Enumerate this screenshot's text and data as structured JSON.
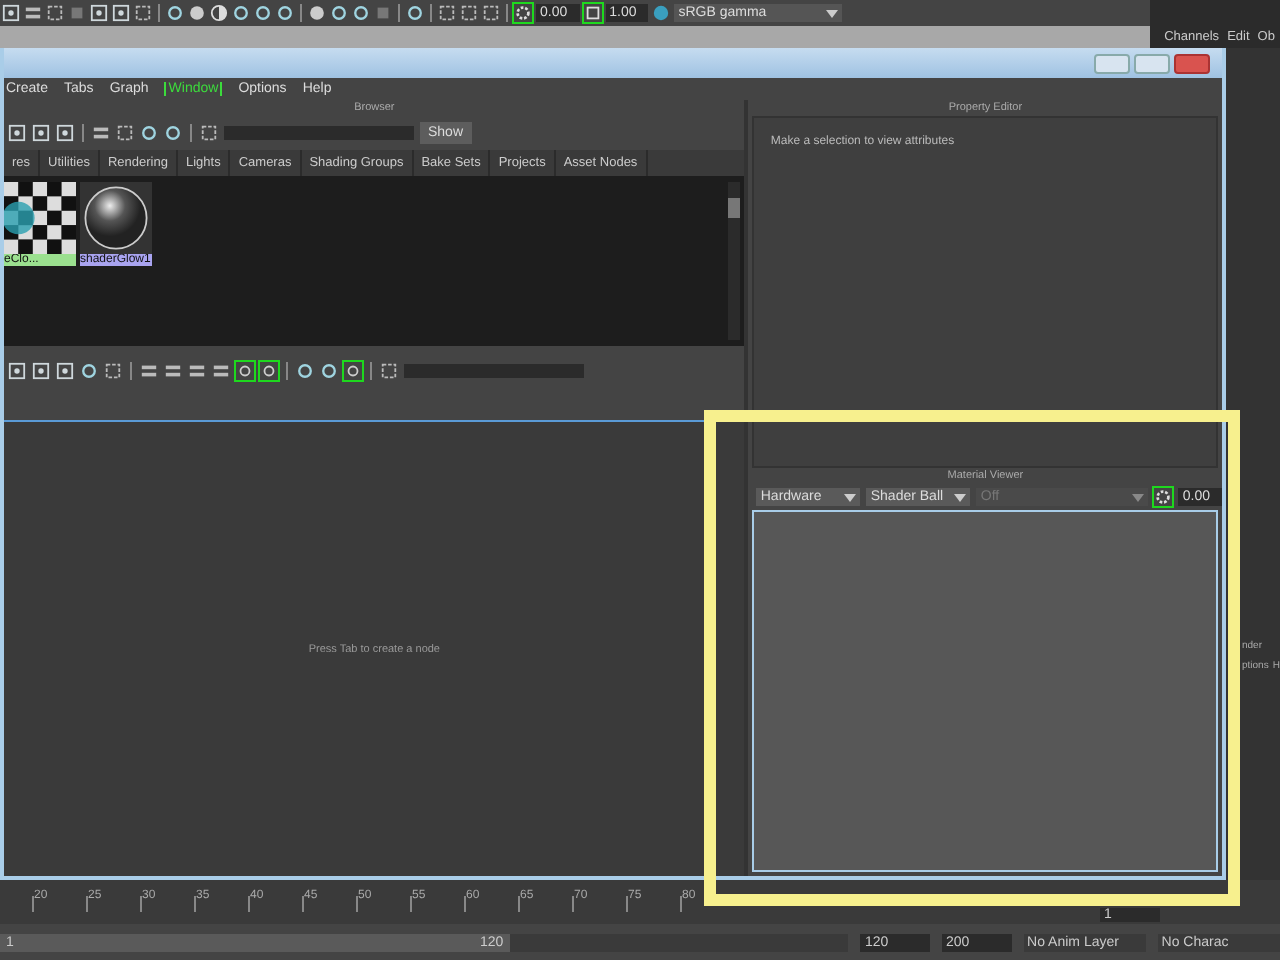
{
  "top_toolbar": {
    "gain": "0.00",
    "gamma": "1.00",
    "color_space": "sRGB gamma"
  },
  "channel_box": {
    "menu": [
      "Channels",
      "Edit",
      "Ob"
    ]
  },
  "window": {
    "menu": [
      {
        "label": "Create",
        "highlighted": false
      },
      {
        "label": "Tabs",
        "highlighted": false
      },
      {
        "label": "Graph",
        "highlighted": false
      },
      {
        "label": "Window",
        "highlighted": true
      },
      {
        "label": "Options",
        "highlighted": false
      },
      {
        "label": "Help",
        "highlighted": false
      }
    ]
  },
  "browser": {
    "title": "Browser",
    "show_button": "Show",
    "tabs": [
      {
        "label": "res",
        "selected": false
      },
      {
        "label": "Utilities",
        "selected": false
      },
      {
        "label": "Rendering",
        "selected": false
      },
      {
        "label": "Lights",
        "selected": false
      },
      {
        "label": "Cameras",
        "selected": false
      },
      {
        "label": "Shading Groups",
        "selected": false
      },
      {
        "label": "Bake Sets",
        "selected": false
      },
      {
        "label": "Projects",
        "selected": false
      },
      {
        "label": "Asset Nodes",
        "selected": false
      }
    ],
    "swatches": [
      {
        "kind": "checker",
        "label": "eClo...",
        "color": "#9be08f"
      },
      {
        "kind": "sphere",
        "label": "shaderGlow1",
        "color": "#a9a4f0"
      }
    ]
  },
  "graph": {
    "hint": "Press Tab to create a node"
  },
  "property_editor": {
    "title": "Property Editor",
    "message": "Make a selection to view attributes"
  },
  "material_viewer": {
    "title": "Material Viewer",
    "renderer": "Hardware",
    "geometry": "Shader Ball",
    "environment": {
      "value": "Off",
      "disabled": true
    },
    "exposure": "0.00"
  },
  "side_panel": {
    "texts": [
      "nder",
      "ptions",
      "H"
    ]
  },
  "timeline": {
    "ticks": [
      "20",
      "25",
      "30",
      "35",
      "40",
      "45",
      "50",
      "55",
      "60",
      "65",
      "70",
      "75",
      "80"
    ],
    "current_frame": "1"
  },
  "range": {
    "level": 0.6,
    "start": "1",
    "slider_end": "120",
    "end": "120",
    "max": "200",
    "anim_layer": "No Anim Layer",
    "character": "No Charac"
  }
}
